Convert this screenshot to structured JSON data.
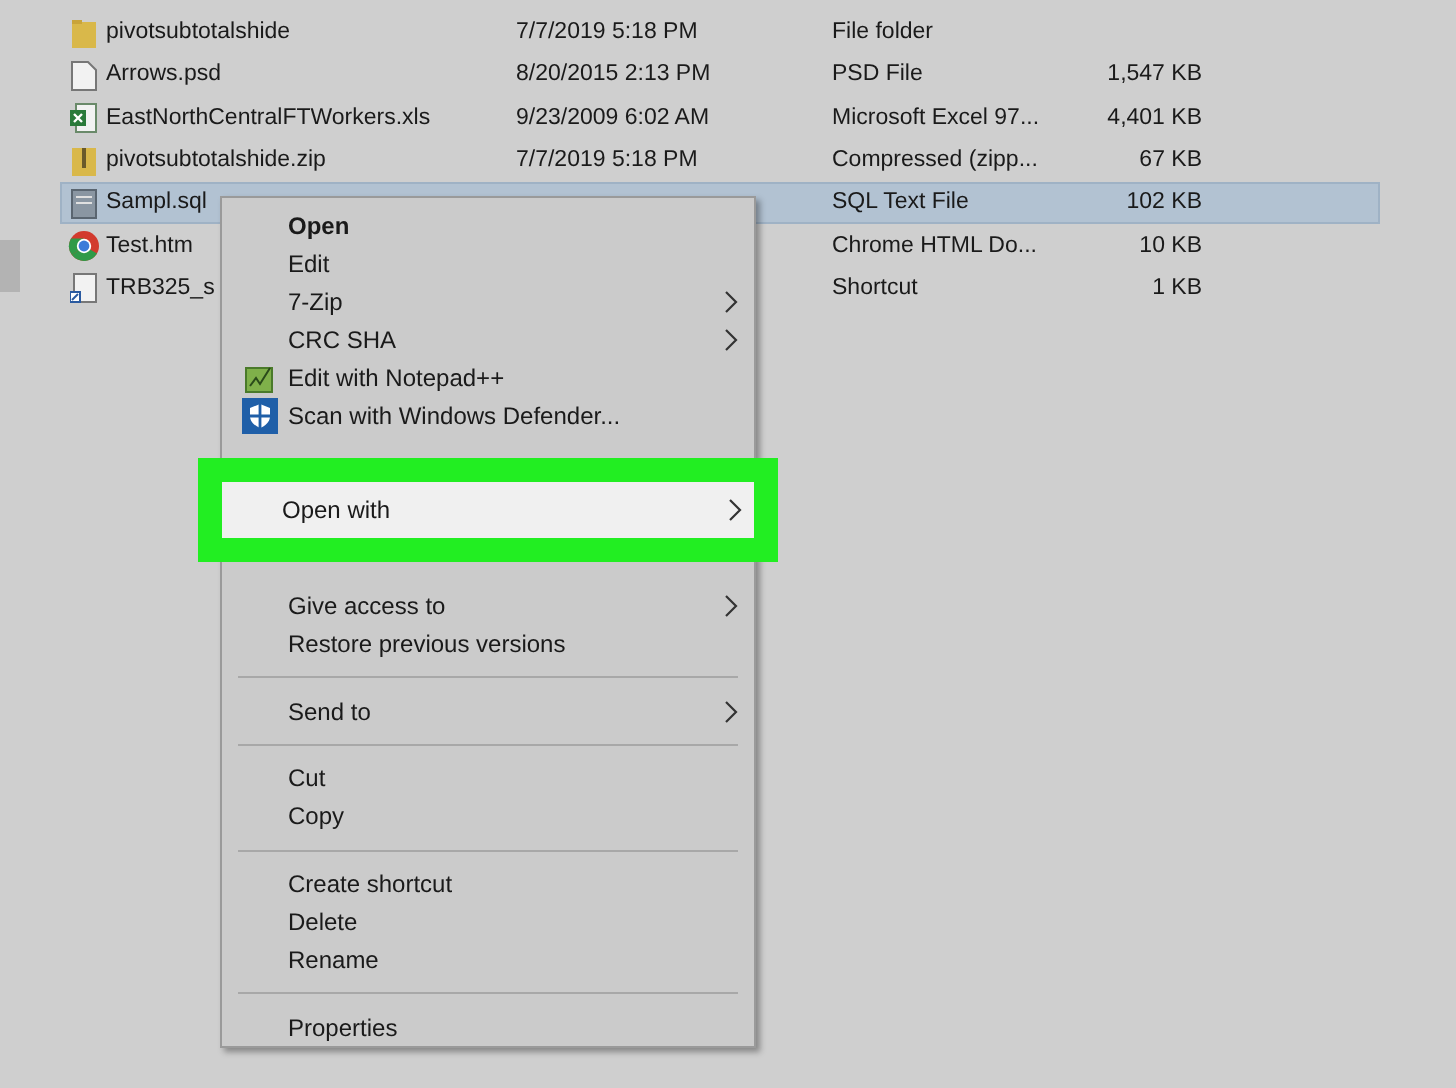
{
  "files": [
    {
      "name": "pivotsubtotalshide",
      "date": "7/7/2019 5:18 PM",
      "type": "File folder",
      "kind": "folder",
      "selected": false
    },
    {
      "name": "Arrows.psd",
      "date": "8/20/2015 2:13 PM",
      "type": "PSD File",
      "size": "1,547 KB",
      "kind": "file",
      "selected": false
    },
    {
      "name": "EastNorthCentralFTWorkers.xls",
      "date": "9/23/2009 6:02 AM",
      "type": "Microsoft Excel 97...",
      "size": "4,401 KB",
      "kind": "excel",
      "selected": false
    },
    {
      "name": "pivotsubtotalshide.zip",
      "date": "7/7/2019 5:18 PM",
      "type": "Compressed (zipp...",
      "size": "67 KB",
      "kind": "zip",
      "selected": false
    },
    {
      "name": "Sampl.sql",
      "type": "SQL Text File",
      "size": "102 KB",
      "kind": "sql",
      "selected": true
    },
    {
      "name": "Test.htm",
      "type": "Chrome HTML Do...",
      "size": "10 KB",
      "kind": "chrome",
      "selected": false
    },
    {
      "name": "TRB325_s",
      "type": "Shortcut",
      "size": "1 KB",
      "kind": "shortcut",
      "selected": false
    }
  ],
  "context_menu": [
    {
      "kind": "item",
      "label": "Open",
      "bold": true,
      "submenu": false,
      "highlighted": false
    },
    {
      "kind": "item",
      "label": "Edit",
      "bold": false,
      "submenu": false,
      "highlighted": false
    },
    {
      "kind": "item",
      "label": "7-Zip",
      "bold": false,
      "submenu": true,
      "highlighted": false
    },
    {
      "kind": "item",
      "label": "CRC SHA",
      "bold": false,
      "submenu": true,
      "highlighted": false
    },
    {
      "kind": "notepad",
      "label": "Edit with Notepad++",
      "bold": false,
      "submenu": false,
      "highlighted": false
    },
    {
      "kind": "defender",
      "label": "Scan with Windows Defender...",
      "bold": false,
      "submenu": false,
      "highlighted": false
    },
    {
      "kind": "item",
      "label": "Open with",
      "bold": false,
      "submenu": true,
      "highlighted": true
    },
    {
      "kind": "item",
      "label": "Give access to",
      "bold": false,
      "submenu": true,
      "highlighted": false
    },
    {
      "kind": "item",
      "label": "Restore previous versions",
      "bold": false,
      "submenu": false,
      "highlighted": false
    },
    {
      "kind": "separator"
    },
    {
      "kind": "item",
      "label": "Send to",
      "bold": false,
      "submenu": true,
      "highlighted": false
    },
    {
      "kind": "separator"
    },
    {
      "kind": "item",
      "label": "Cut",
      "bold": false,
      "submenu": false,
      "highlighted": false
    },
    {
      "kind": "item",
      "label": "Copy",
      "bold": false,
      "submenu": false,
      "highlighted": false
    },
    {
      "kind": "separator"
    },
    {
      "kind": "item",
      "label": "Create shortcut",
      "bold": false,
      "submenu": false,
      "highlighted": false
    },
    {
      "kind": "item",
      "label": "Delete",
      "bold": false,
      "submenu": false,
      "highlighted": false
    },
    {
      "kind": "item",
      "label": "Rename",
      "bold": false,
      "submenu": false,
      "highlighted": false
    },
    {
      "kind": "separator"
    },
    {
      "kind": "item",
      "label": "Properties",
      "bold": false,
      "submenu": false,
      "highlighted": false
    }
  ]
}
